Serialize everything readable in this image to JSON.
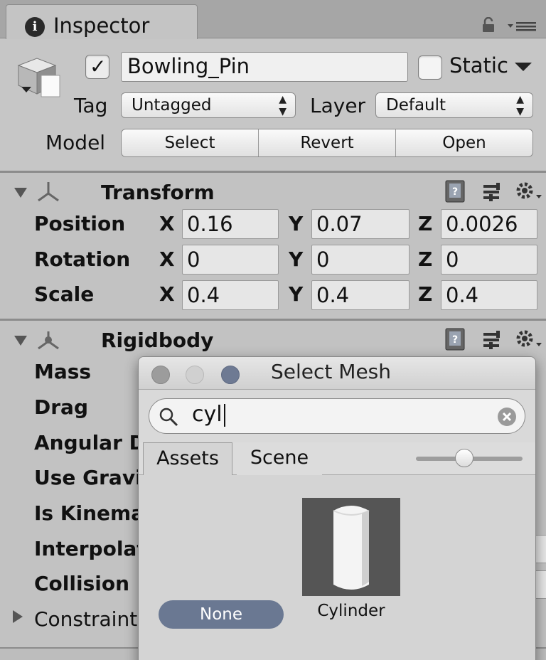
{
  "tab": {
    "title": "Inspector"
  },
  "gameobject": {
    "active": true,
    "name": "Bowling_Pin",
    "static_label": "Static",
    "static_checked": false,
    "tag_label": "Tag",
    "tag_value": "Untagged",
    "layer_label": "Layer",
    "layer_value": "Default",
    "model_label": "Model",
    "model_buttons": [
      "Select",
      "Revert",
      "Open"
    ]
  },
  "transform": {
    "title": "Transform",
    "rows": [
      {
        "label": "Position",
        "x": "0.16",
        "y": "0.07",
        "z": "0.0026"
      },
      {
        "label": "Rotation",
        "x": "0",
        "y": "0",
        "z": "0"
      },
      {
        "label": "Scale",
        "x": "0.4",
        "y": "0.4",
        "z": "0.4"
      }
    ],
    "axis_labels": [
      "X",
      "Y",
      "Z"
    ]
  },
  "rigidbody": {
    "title": "Rigidbody",
    "properties": [
      "Mass",
      "Drag",
      "Angular D",
      "Use Gravi",
      "Is Kinema",
      "Interpolat",
      "Collision",
      "Constraint"
    ]
  },
  "popup": {
    "title": "Select Mesh",
    "search_value": "cyl",
    "tabs": [
      "Assets",
      "Scene"
    ],
    "active_tab": "Assets",
    "zoom_level": 0.45,
    "none_label": "None",
    "items": [
      {
        "label": "Cylinder",
        "icon": "cylinder-mesh-icon"
      }
    ]
  },
  "colors": {
    "panel_bg": "#c2c2c2",
    "selection_blue": "#6a7892",
    "traffic_close": "#9c9c9c",
    "traffic_min": "#d0d0d0",
    "traffic_max": "#6e7a93"
  }
}
